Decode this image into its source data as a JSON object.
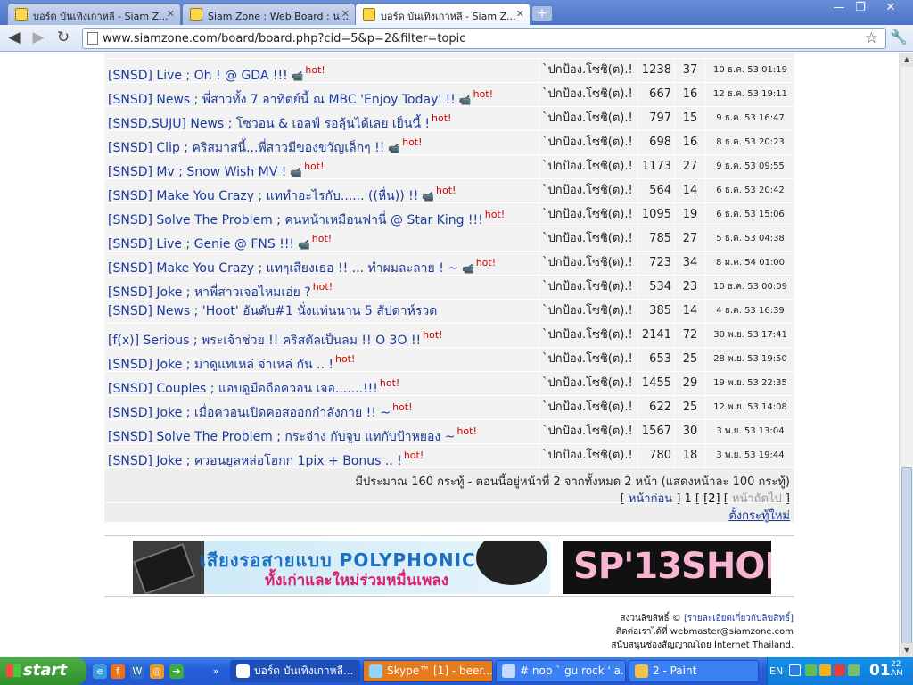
{
  "browser": {
    "tabs": [
      {
        "title": "บอร์ด บันเทิงเกาหลี - Siam Z...",
        "active": false
      },
      {
        "title": "Siam Zone : Web Board : น...",
        "active": false
      },
      {
        "title": "บอร์ด บันเทิงเกาหลี - Siam Z...",
        "active": true
      }
    ],
    "new_tab_label": "+",
    "url": "www.siamzone.com/board/board.php?cid=5&p=2&filter=topic",
    "window_controls": {
      "minimize": "—",
      "maximize": "❐",
      "close": "✕"
    }
  },
  "board": {
    "rows": [
      {
        "title": "[SNSD] Live ; Oh ! @ GDA !!!",
        "cam": true,
        "hot": "hot!",
        "author": "`ปกป้อง.โซชิ(ต).!",
        "views": "1238",
        "replies": "37",
        "date": "10 ธ.ค. 53 01:19"
      },
      {
        "title": "[SNSD] News ; พี่สาวทั้ง 7 อาทิตย์นี้ ณ MBC 'Enjoy Today' !!",
        "cam": true,
        "hot": "hot!",
        "author": "`ปกป้อง.โซชิ(ต).!",
        "views": "667",
        "replies": "16",
        "date": "12 ธ.ค. 53 19:11"
      },
      {
        "title": "[SNSD,SUJU] News ; โซวอน & เอลฟ์ รอลุ้นได้เลย เย็นนี้ !",
        "cam": false,
        "hot": "hot!",
        "author": "`ปกป้อง.โซชิ(ต).!",
        "views": "797",
        "replies": "15",
        "date": "9 ธ.ค. 53 16:47"
      },
      {
        "title": "[SNSD] Clip ; คริสมาสนี้...พี่สาวมีของขวัญเล็กๆ !!",
        "cam": true,
        "hot": "hot!",
        "author": "`ปกป้อง.โซชิ(ต).!",
        "views": "698",
        "replies": "16",
        "date": "8 ธ.ค. 53 20:23"
      },
      {
        "title": "[SNSD] Mv ; Snow Wish MV !",
        "cam": true,
        "hot": "hot!",
        "author": "`ปกป้อง.โซชิ(ต).!",
        "views": "1173",
        "replies": "27",
        "date": "9 ธ.ค. 53 09:55"
      },
      {
        "title": "[SNSD] Make You Crazy ; แททำอะไรกับ...... ((หื่น)) !!",
        "cam": true,
        "hot": "hot!",
        "author": "`ปกป้อง.โซชิ(ต).!",
        "views": "564",
        "replies": "14",
        "date": "6 ธ.ค. 53 20:42"
      },
      {
        "title": "[SNSD] Solve The Problem ; คนหน้าเหมือนฟานี่ @ Star King !!!",
        "cam": false,
        "hot": "hot!",
        "author": "`ปกป้อง.โซชิ(ต).!",
        "views": "1095",
        "replies": "19",
        "date": "6 ธ.ค. 53 15:06"
      },
      {
        "title": "[SNSD] Live ; Genie @ FNS !!!",
        "cam": true,
        "hot": "hot!",
        "author": "`ปกป้อง.โซชิ(ต).!",
        "views": "785",
        "replies": "27",
        "date": "5 ธ.ค. 53 04:38"
      },
      {
        "title": "[SNSD] Make You Crazy ; แทๆเสียงเธอ !! ... ทำผมละลาย ! ~",
        "cam": true,
        "hot": "hot!",
        "author": "`ปกป้อง.โซชิ(ต).!",
        "views": "723",
        "replies": "34",
        "date": "8 ม.ค. 54 01:00"
      },
      {
        "title": "[SNSD] Joke ; หาพี่สาวเจอไหมเอ่ย ?",
        "cam": false,
        "hot": "hot!",
        "author": "`ปกป้อง.โซชิ(ต).!",
        "views": "534",
        "replies": "23",
        "date": "10 ธ.ค. 53 00:09"
      },
      {
        "title": "[SNSD] News ; 'Hoot' อันดับ#1 นั่งแท่นนาน 5 สัปดาห์รวด",
        "cam": false,
        "hot": "",
        "author": "`ปกป้อง.โซชิ(ต).!",
        "views": "385",
        "replies": "14",
        "date": "4 ธ.ค. 53 16:39"
      },
      {
        "title": "[f(x)] Serious ; พระเจ้าช่วย !! คริสตัลเป็นลม !! O 3O !!",
        "cam": false,
        "hot": "hot!",
        "author": "`ปกป้อง.โซชิ(ต).!",
        "views": "2141",
        "replies": "72",
        "date": "30 พ.ย. 53 17:41"
      },
      {
        "title": "[SNSD] Joke ; มาดูแทเหล่ จ่าเหล่ กัน .. !",
        "cam": false,
        "hot": "hot!",
        "author": "`ปกป้อง.โซชิ(ต).!",
        "views": "653",
        "replies": "25",
        "date": "28 พ.ย. 53 19:50"
      },
      {
        "title": "[SNSD] Couples ; แอบดูมือถือควอน เจอ.......!!!",
        "cam": false,
        "hot": "hot!",
        "author": "`ปกป้อง.โซชิ(ต).!",
        "views": "1455",
        "replies": "29",
        "date": "19 พ.ย. 53 22:35"
      },
      {
        "title": "[SNSD] Joke ; เมื่อควอนเปิดคอสออกกำลังกาย !! ~",
        "cam": false,
        "hot": "hot!",
        "author": "`ปกป้อง.โซชิ(ต).!",
        "views": "622",
        "replies": "25",
        "date": "12 พ.ย. 53 14:08"
      },
      {
        "title": "[SNSD] Solve The Problem ; กระจ่าง กับจูบ แทกับป้าหยอง ~",
        "cam": false,
        "hot": "hot!",
        "author": "`ปกป้อง.โซชิ(ต).!",
        "views": "1567",
        "replies": "30",
        "date": "3 พ.ย. 53 13:04"
      },
      {
        "title": "[SNSD] Joke ; ควอนยูลหล่อโฮกก 1pix + Bonus .. !",
        "cam": false,
        "hot": "hot!",
        "author": "`ปกป้อง.โซชิ(ต).!",
        "views": "780",
        "replies": "18",
        "date": "3 พ.ย. 53 19:44"
      }
    ],
    "summary": "มีประมาณ 160 กระทู้ - ตอนนี้อยู่หน้าที่ 2 จากทั้งหมด 2 หน้า (แสดงหน้าละ 100 กระทู้)",
    "pager": {
      "open": "[",
      "prev": "หน้าก่อน",
      "mid": "] 1 [",
      "current": "[2]",
      "open2": "[",
      "next": "หน้าถัดไป",
      "close": "]"
    },
    "new_topic": "ตั้งกระทู้ใหม่"
  },
  "ads": {
    "ad1_line1": "เสียงรอสายแบบ POLYPHONIC",
    "ad1_line2": "ทั้งเก่าและใหม่ร่วมหมื่นเพลง",
    "ad2_text": "SP'13SHOP"
  },
  "footer": {
    "copyright": "สงวนลิขสิทธิ์ ©",
    "copyright_link": "[รายละเอียดเกี่ยวกับลิขสิทธิ์]",
    "contact": "ติดต่อเราได้ที่ webmaster@siamzone.com",
    "sponsor": "สนับสนุนช่องสัญญาณโดย Internet Thailand."
  },
  "taskbar": {
    "start": "start",
    "more": "»",
    "buttons": [
      {
        "label": "บอร์ด บันเทิงเกาหลี...",
        "active": true
      },
      {
        "label": "Skype™ [1] - beer...",
        "active": false
      },
      {
        "label": "# nop ` gu rock ' a...",
        "active": false
      },
      {
        "label": "2 - Paint",
        "active": false
      }
    ],
    "lang": "EN",
    "clock": "01",
    "clock_small": "22 AM"
  },
  "colors": {
    "link": "#1a3a9c",
    "hot": "#d40000",
    "row_bg": "#f2f2f2"
  }
}
